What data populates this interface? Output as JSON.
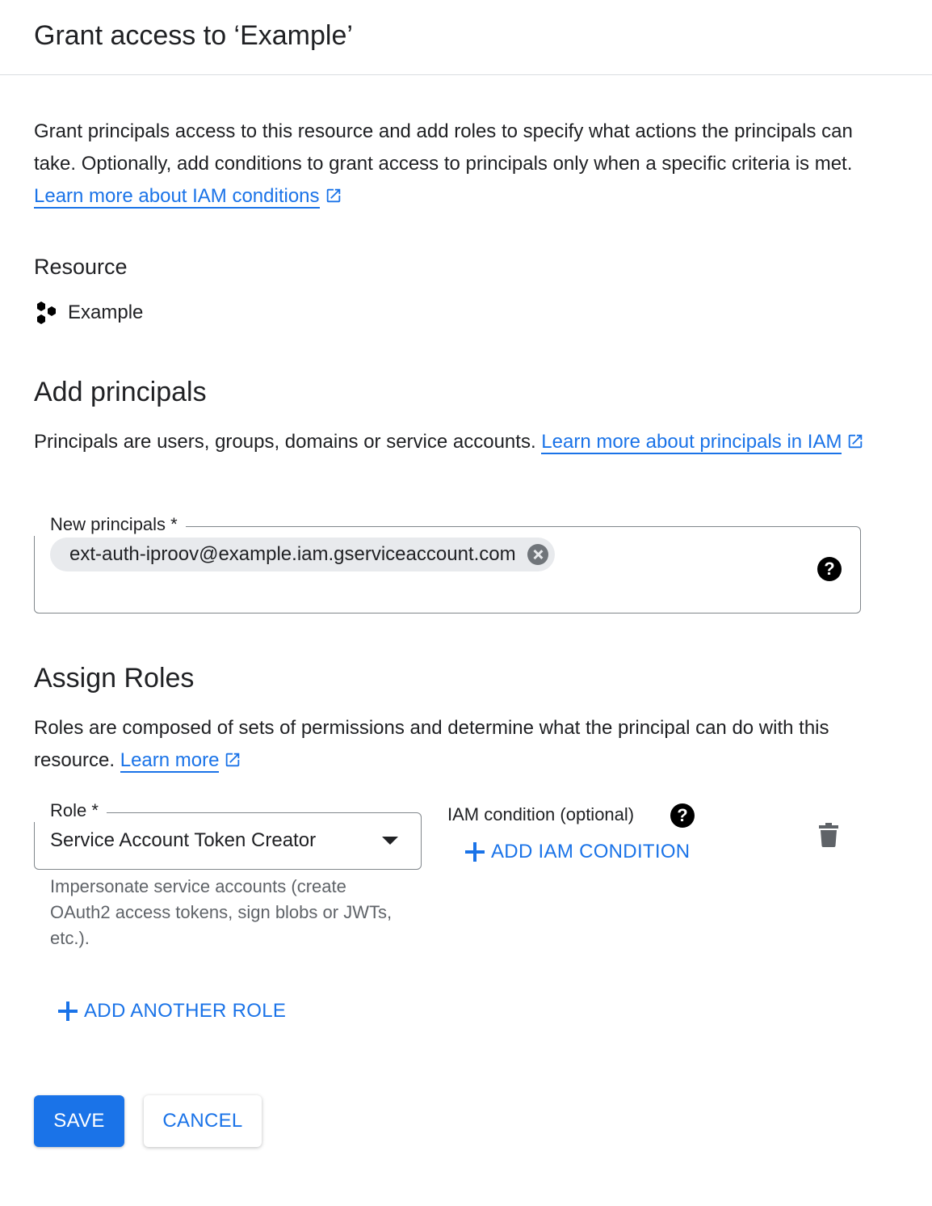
{
  "header": {
    "title": "Grant access to ‘Example’"
  },
  "intro": {
    "text": "Grant principals access to this resource and add roles to specify what actions the principals can take. Optionally, add conditions to grant access to principals only when a specific criteria is met.",
    "link": "Learn more about IAM conditions"
  },
  "resource": {
    "label": "Resource",
    "name": "Example",
    "icon": "hexagon-cluster-icon"
  },
  "principals": {
    "heading": "Add principals",
    "description": "Principals are users, groups, domains or service accounts.",
    "link": "Learn more about principals in IAM",
    "field_label": "New principals *",
    "chip_value": "ext-auth-iproov@example.iam.gserviceaccount.com"
  },
  "roles": {
    "heading": "Assign Roles",
    "description": "Roles are composed of sets of permissions and determine what the principal can do with this resource.",
    "link": "Learn more",
    "role_label": "Role *",
    "role_value": "Service Account Token Creator",
    "role_description": "Impersonate service accounts (create OAuth2 access tokens, sign blobs or JWTs, etc.).",
    "condition_label": "IAM condition (optional)",
    "add_condition": "ADD IAM CONDITION",
    "add_role": "ADD ANOTHER ROLE"
  },
  "actions": {
    "save": "SAVE",
    "cancel": "CANCEL"
  },
  "colors": {
    "accent": "#1a73e8",
    "text": "#202124",
    "muted": "#5f6368",
    "chip_bg": "#e8eaed"
  }
}
